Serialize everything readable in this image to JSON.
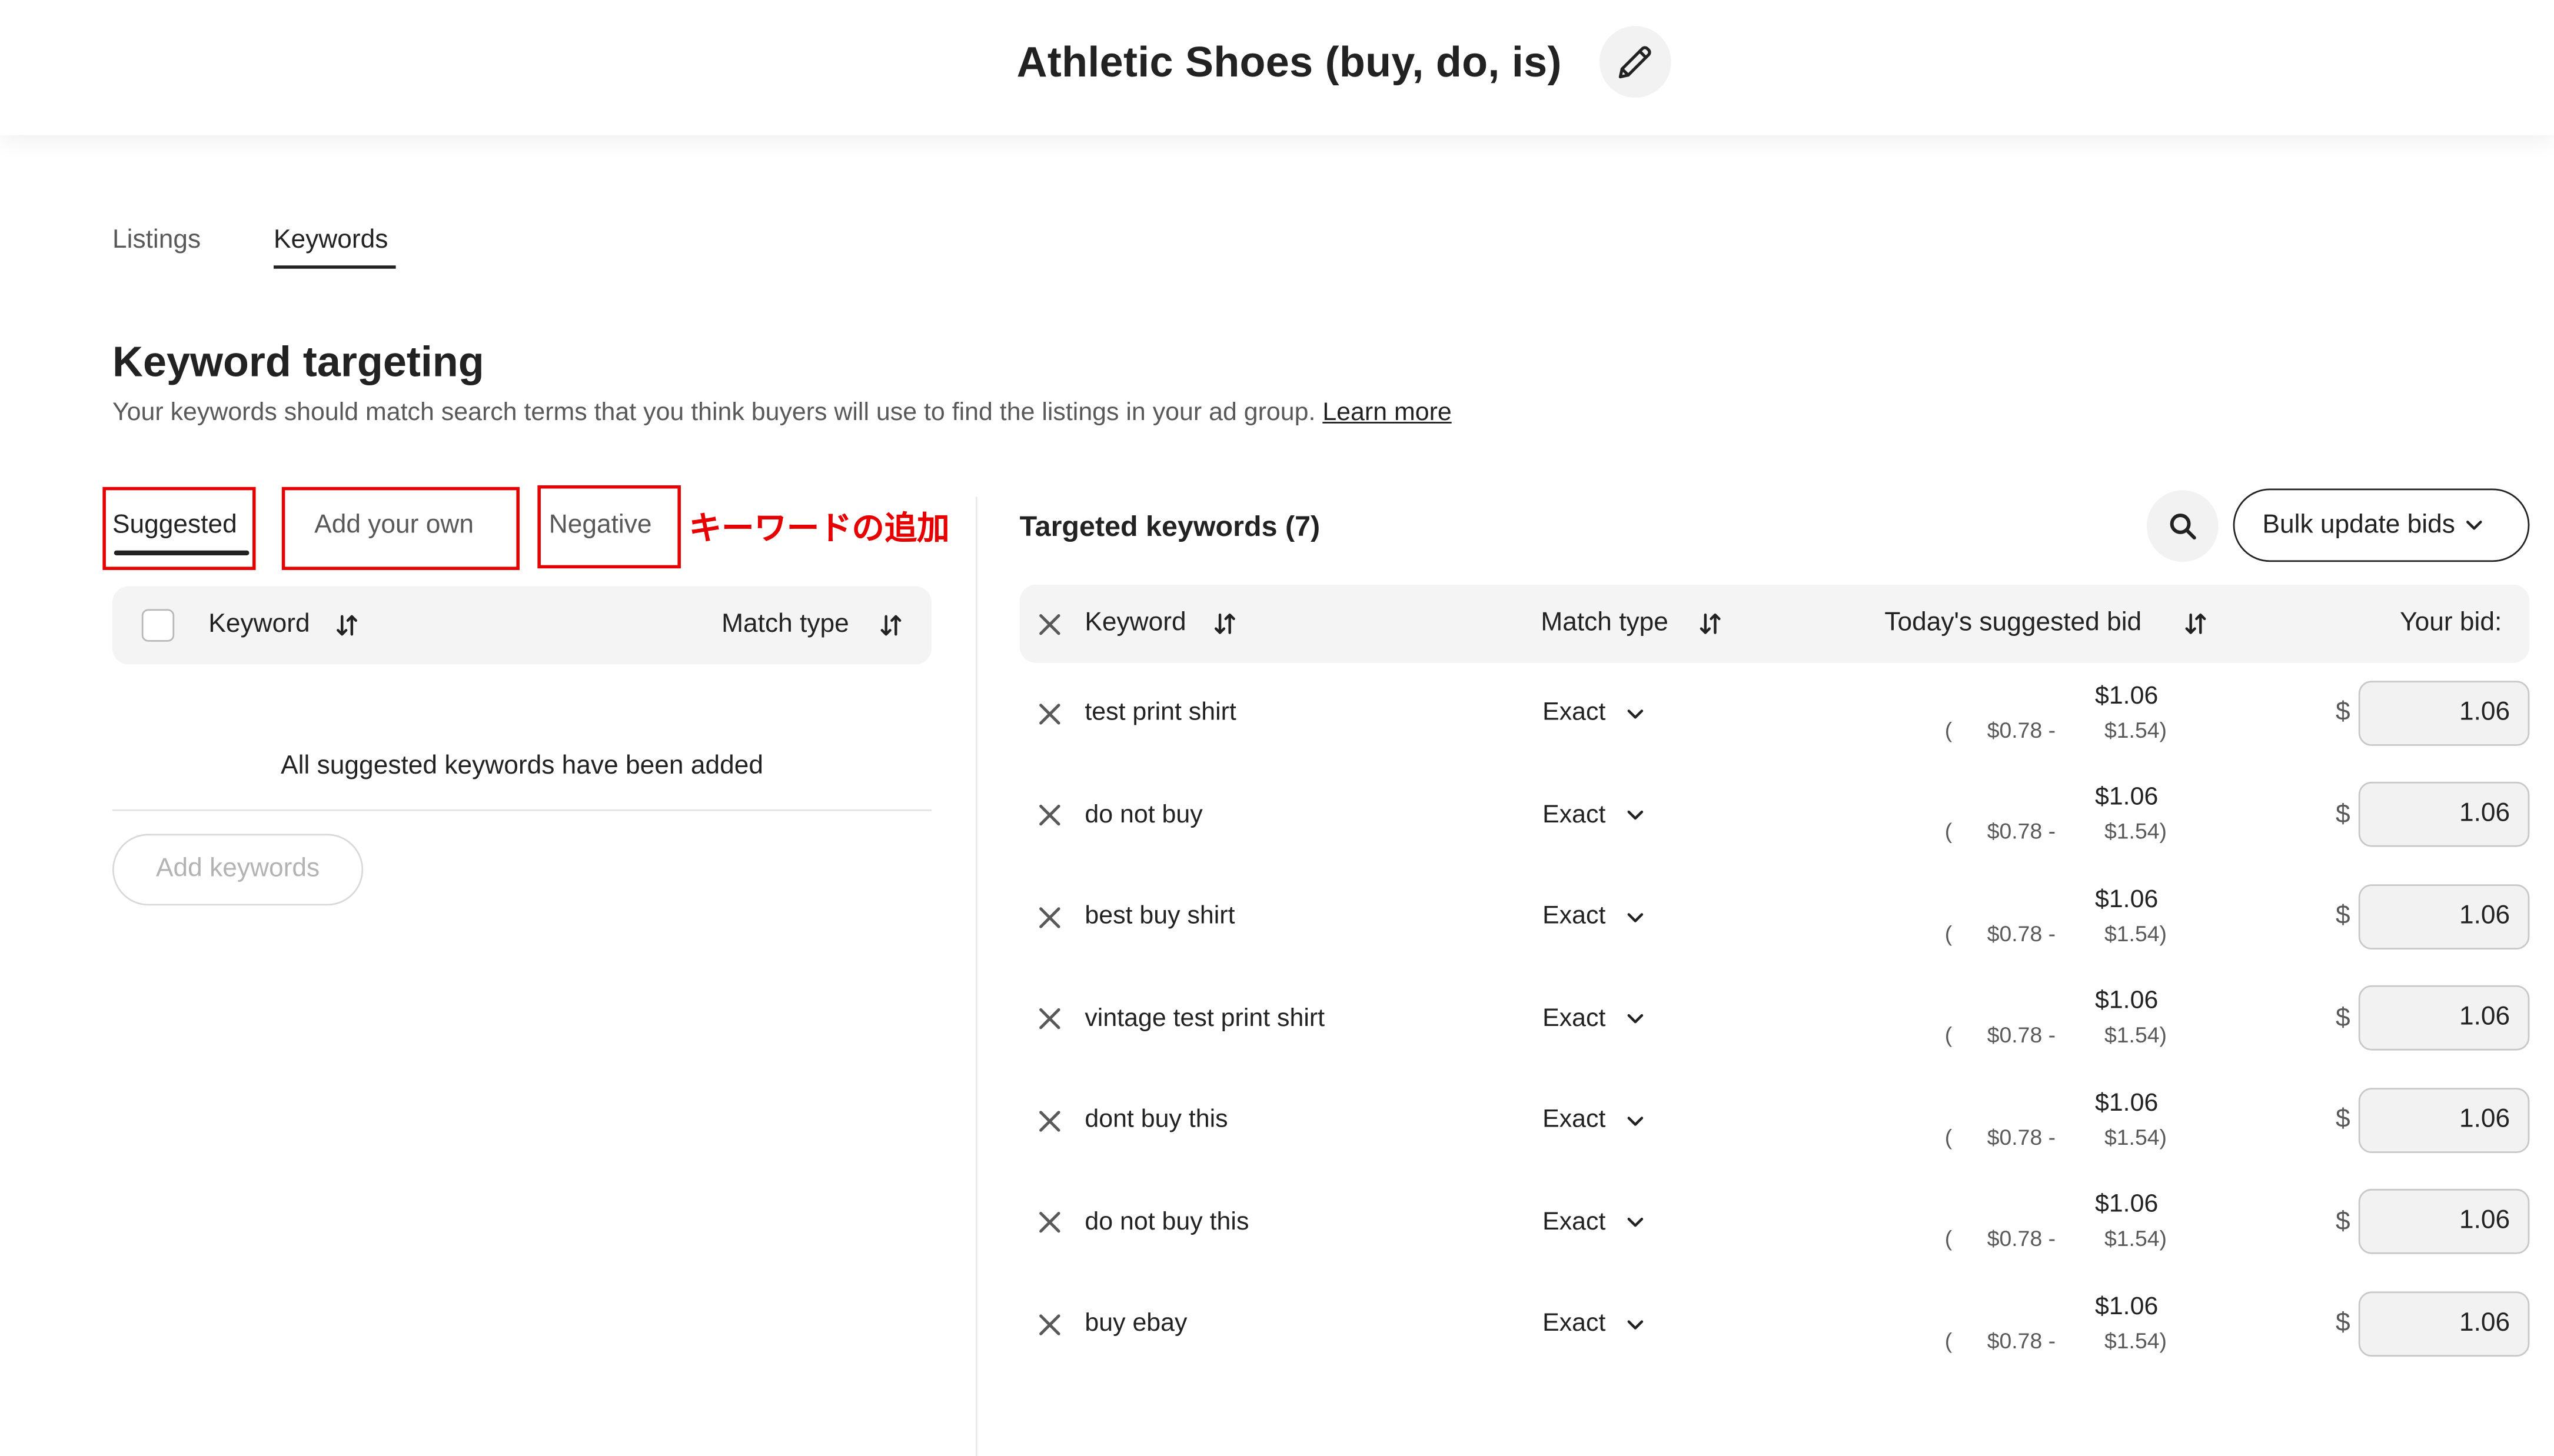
{
  "colors": {
    "text": "#222222",
    "secondary_text": "#595959",
    "annotation_red": "#e60000",
    "panel_gray": "#f4f4f4"
  },
  "icons": {
    "edit": "pencil-icon",
    "search": "search-icon",
    "sort": "sort-icon",
    "remove": "close-icon",
    "dropdown": "chevron-down-icon"
  },
  "header": {
    "title": "Athletic Shoes (buy, do, is)"
  },
  "tabs": [
    {
      "label": "Listings",
      "active": false
    },
    {
      "label": "Keywords",
      "active": true
    }
  ],
  "section": {
    "title": "Keyword targeting",
    "description": "Your keywords should match search terms that you think buyers will use to find the listings in your ad group. ",
    "learn_more": "Learn more"
  },
  "left_panel": {
    "subtabs": [
      {
        "label": "Suggested",
        "active": true
      },
      {
        "label": "Add your own",
        "active": false
      },
      {
        "label": "Negative",
        "active": false
      }
    ],
    "annotation": "キーワードの追加",
    "columns": {
      "keyword": "Keyword",
      "match_type": "Match type"
    },
    "select_all_checked": false,
    "empty_message": "All suggested keywords have been added",
    "add_button": "Add keywords",
    "add_button_enabled": false
  },
  "right_panel": {
    "title": "Targeted keywords (7)",
    "bulk_button": "Bulk update bids",
    "columns": {
      "keyword": "Keyword",
      "match_type": "Match type",
      "suggested_bid": "Today's suggested bid",
      "your_bid": "Your bid:"
    },
    "currency_symbol": "$",
    "rows": [
      {
        "keyword": "test print shirt",
        "match_type": "Exact",
        "suggested_bid": "$1.06",
        "range_open": "(",
        "range_low": "$0.78 -",
        "range_high": "$1.54)",
        "bid": "1.06"
      },
      {
        "keyword": "do not buy",
        "match_type": "Exact",
        "suggested_bid": "$1.06",
        "range_open": "(",
        "range_low": "$0.78 -",
        "range_high": "$1.54)",
        "bid": "1.06"
      },
      {
        "keyword": "best buy shirt",
        "match_type": "Exact",
        "suggested_bid": "$1.06",
        "range_open": "(",
        "range_low": "$0.78 -",
        "range_high": "$1.54)",
        "bid": "1.06"
      },
      {
        "keyword": "vintage test print shirt",
        "match_type": "Exact",
        "suggested_bid": "$1.06",
        "range_open": "(",
        "range_low": "$0.78 -",
        "range_high": "$1.54)",
        "bid": "1.06"
      },
      {
        "keyword": "dont buy this",
        "match_type": "Exact",
        "suggested_bid": "$1.06",
        "range_open": "(",
        "range_low": "$0.78 -",
        "range_high": "$1.54)",
        "bid": "1.06"
      },
      {
        "keyword": "do not buy this",
        "match_type": "Exact",
        "suggested_bid": "$1.06",
        "range_open": "(",
        "range_low": "$0.78 -",
        "range_high": "$1.54)",
        "bid": "1.06"
      },
      {
        "keyword": "buy ebay",
        "match_type": "Exact",
        "suggested_bid": "$1.06",
        "range_open": "(",
        "range_low": "$0.78 -",
        "range_high": "$1.54)",
        "bid": "1.06"
      }
    ]
  }
}
